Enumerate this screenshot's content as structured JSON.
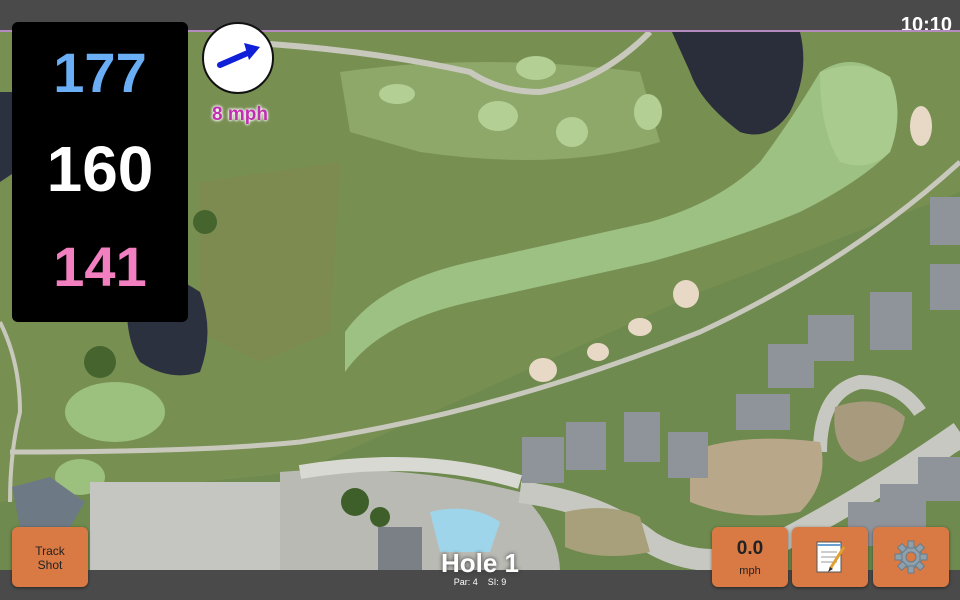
{
  "status": {
    "clock": "10:10"
  },
  "distances": {
    "back": "177",
    "middle": "160",
    "front": "141"
  },
  "wind": {
    "speed_label": "8 mph",
    "direction_icon": "arrow-icon"
  },
  "hole": {
    "title": "Hole 1",
    "par_label": "Par: 4",
    "si_label": "SI: 9"
  },
  "buttons": {
    "track_shot_line1": "Track",
    "track_shot_line2": "Shot",
    "speed_value": "0.0",
    "speed_unit": "mph",
    "notes_icon": "notepad-icon",
    "settings_icon": "gear-icon"
  },
  "colors": {
    "back": "#6aaef5",
    "middle": "#ffffff",
    "front": "#f27fc0",
    "wind": "#c02fb0",
    "button": "#d97a45"
  }
}
